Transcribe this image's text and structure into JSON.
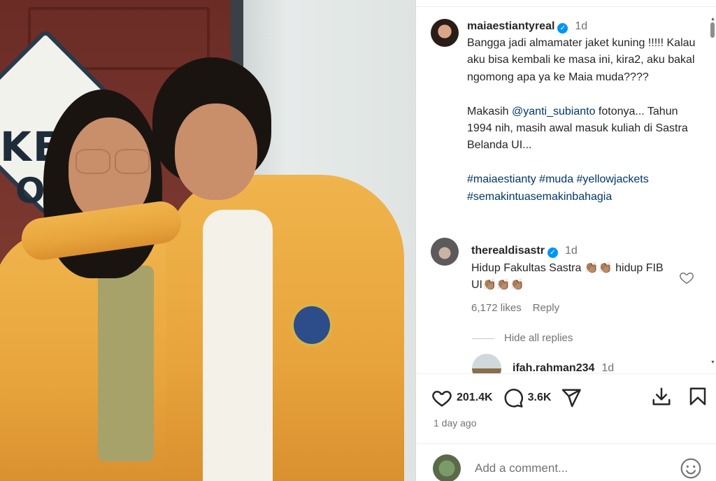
{
  "post": {
    "username": "maiaestiantyreal",
    "time": "1d",
    "caption_lines_1": "Bangga jadi almamater jaket kuning !!!!! Kalau aku bisa kembali ke masa ini, kira2, aku bakal ngomong apa ya ke Maia muda????",
    "caption_2_pre": "Makasih ",
    "caption_2_mention": "@yanti_subianto",
    "caption_2_post": " fotonya... Tahun 1994 nih, masih awal masuk kuliah di Sastra Belanda UI...",
    "hashtags": "#maiaestianty #muda #yellowjackets #semakintuasemakinbahagia"
  },
  "reply": {
    "username": "therealdisastr",
    "time": "1d",
    "text": "Hidup Fakultas Sastra 👏🏽👏🏽 hidup FIB UI👏🏽👏🏽👏🏽",
    "likes": "6,172 likes",
    "reply_label": "Reply",
    "hide_replies": "Hide all replies"
  },
  "nested_reply": {
    "username": "ifah.rahman234",
    "time": "1d"
  },
  "actions": {
    "likes_count": "201.4K",
    "comments_count": "3.6K",
    "date": "1 day ago"
  },
  "comment_box": {
    "placeholder": "Add a comment..."
  },
  "colors": {
    "verified": "#0095f6",
    "link": "#00376b",
    "muted": "#737373"
  },
  "icons": [
    "heart-icon",
    "comment-icon",
    "share-icon",
    "download-icon",
    "bookmark-icon",
    "emoji-icon",
    "verified-icon"
  ]
}
